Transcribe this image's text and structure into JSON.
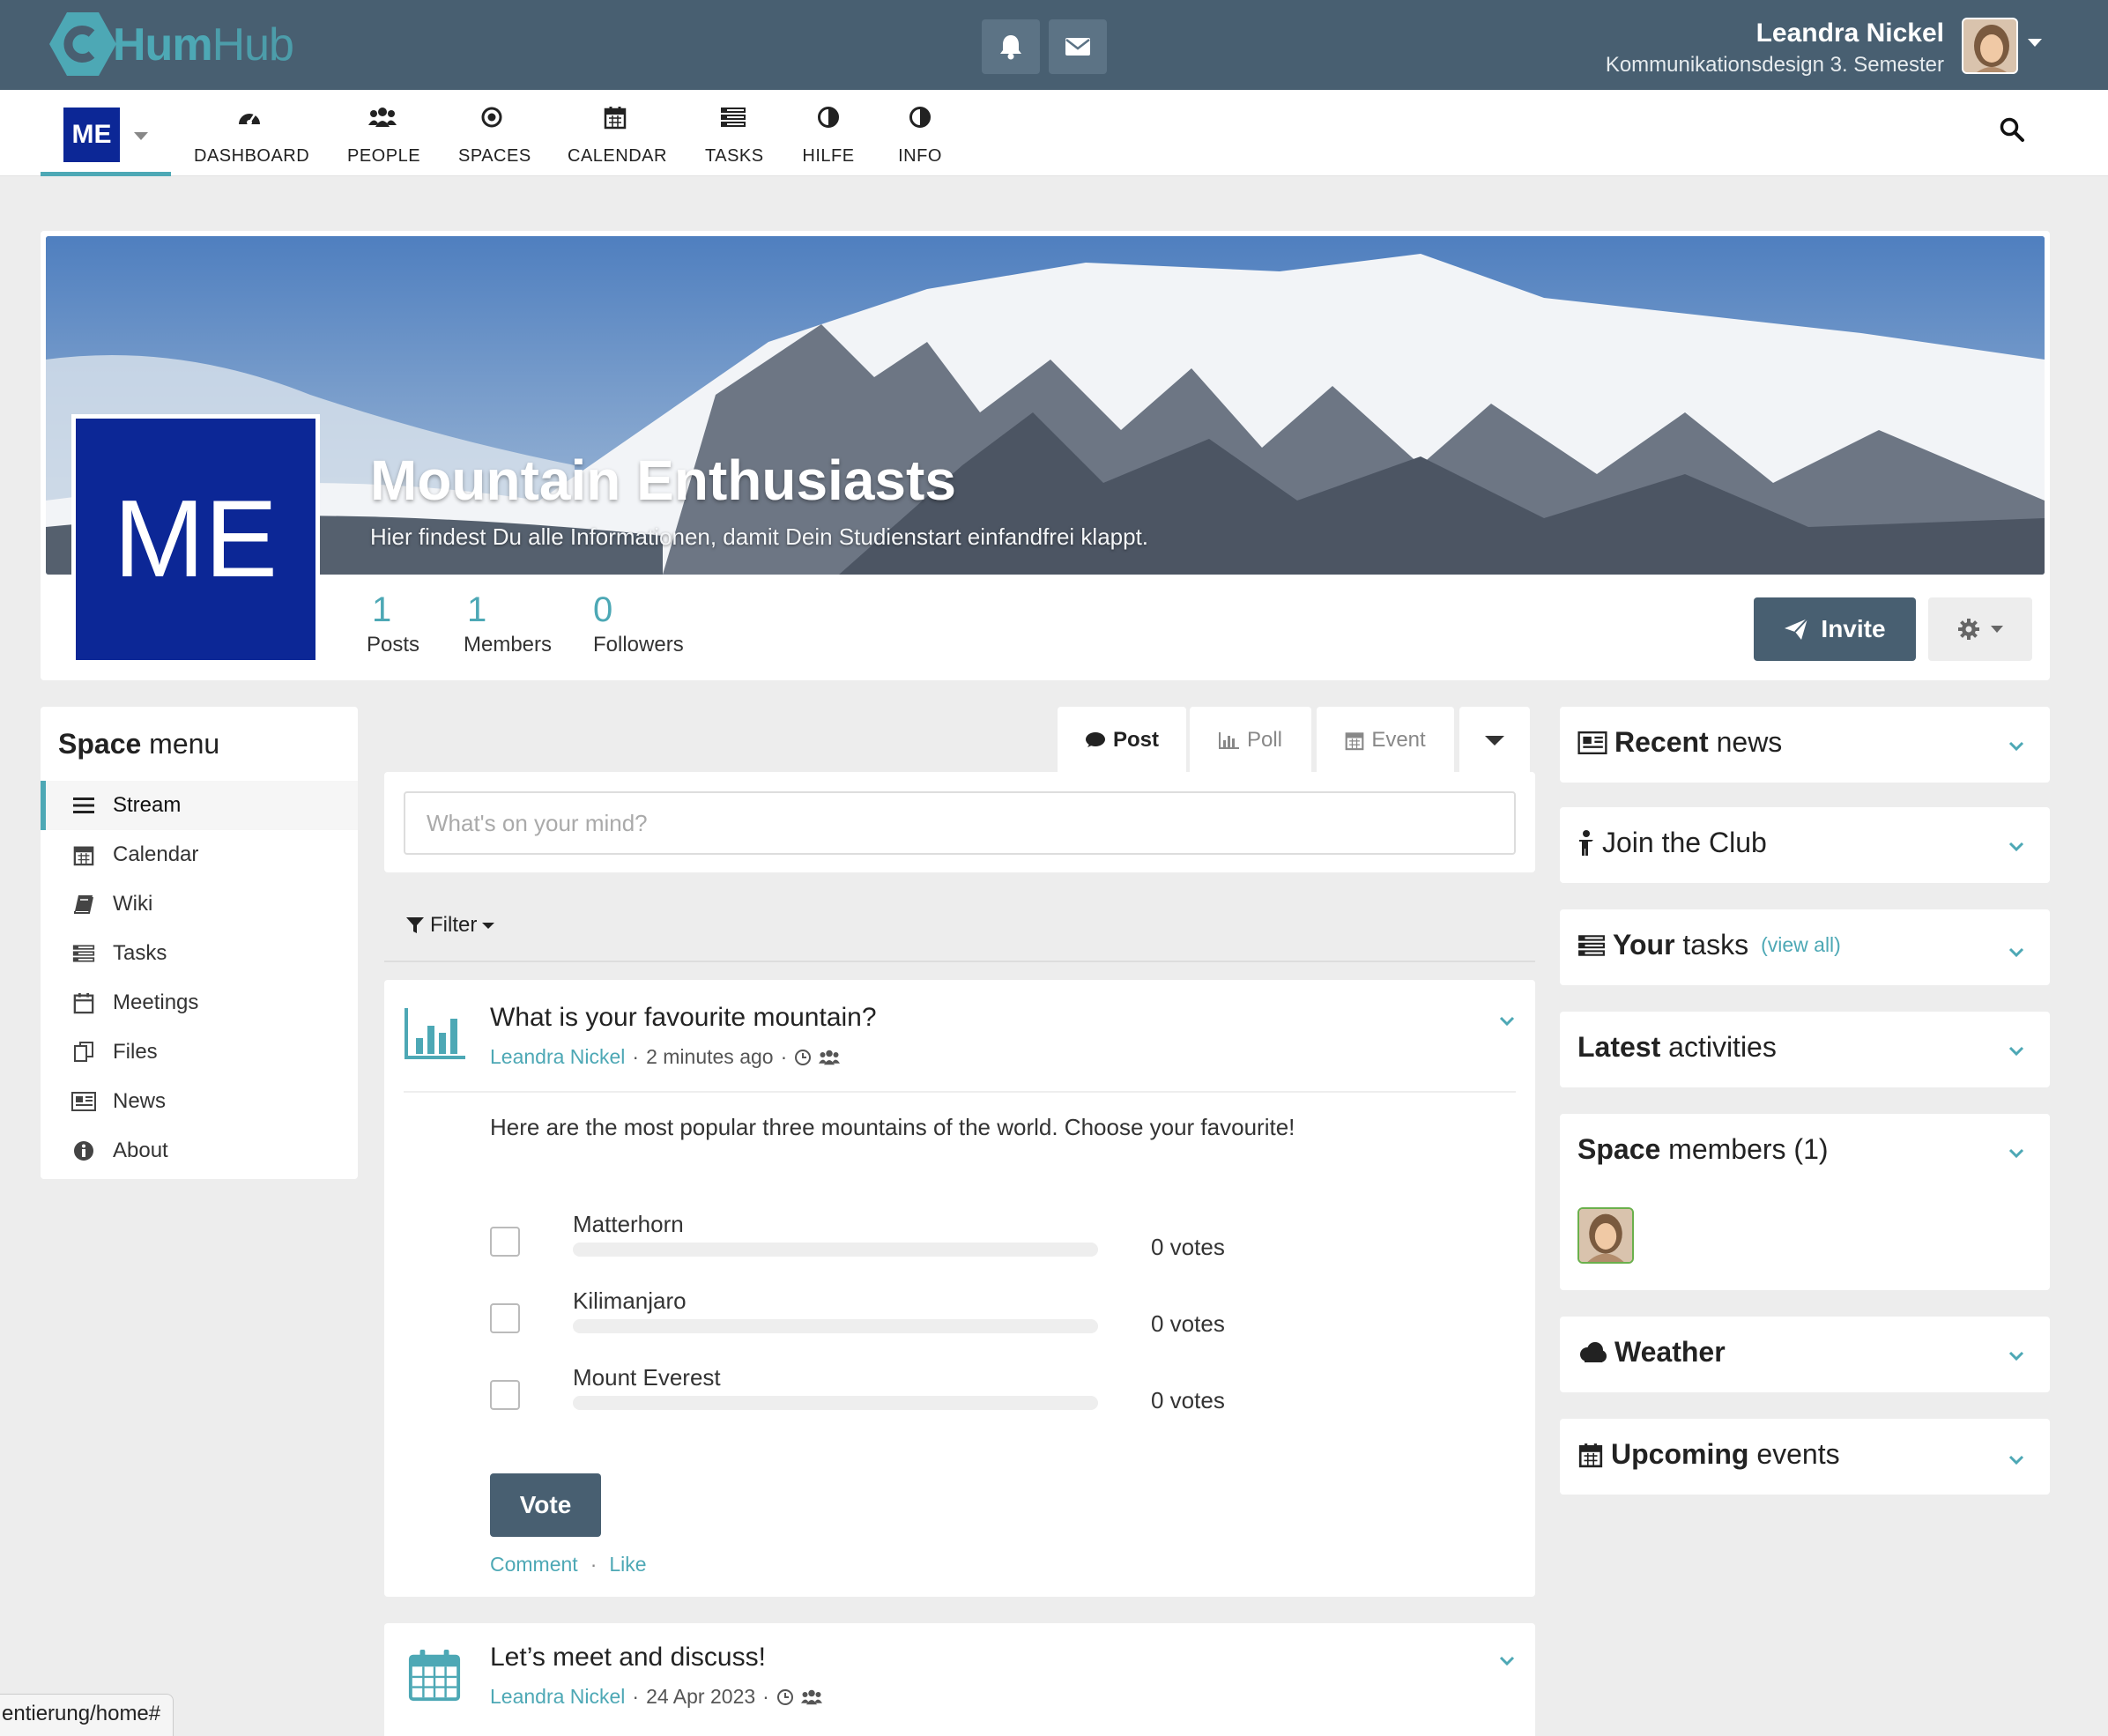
{
  "app": {
    "brand_bold": "Hum",
    "brand_light": "Hub",
    "brand_prefix": "C"
  },
  "user": {
    "name": "Leandra Nickel",
    "role": "Kommunikationsdesign 3. Semester"
  },
  "space_chooser": {
    "initials": "ME"
  },
  "nav": [
    {
      "label": "DASHBOARD",
      "icon": "dashboard-icon"
    },
    {
      "label": "PEOPLE",
      "icon": "people-icon"
    },
    {
      "label": "SPACES",
      "icon": "spaces-icon"
    },
    {
      "label": "CALENDAR",
      "icon": "calendar-icon"
    },
    {
      "label": "TASKS",
      "icon": "tasks-icon"
    },
    {
      "label": "HILFE",
      "icon": "contrast-icon"
    },
    {
      "label": "INFO",
      "icon": "contrast-icon"
    }
  ],
  "space": {
    "initials": "ME",
    "title": "Mountain Enthusiasts",
    "description": "Hier findest Du alle Informationen, damit Dein Studienstart einfandfrei klappt.",
    "stats": [
      {
        "value": "1",
        "label": "Posts"
      },
      {
        "value": "1",
        "label": "Members"
      },
      {
        "value": "0",
        "label": "Followers"
      }
    ],
    "invite_label": "Invite"
  },
  "space_menu": {
    "title_bold": "Space",
    "title_rest": " menu",
    "items": [
      {
        "label": "Stream",
        "icon": "stream-icon",
        "active": true
      },
      {
        "label": "Calendar",
        "icon": "calendar-icon",
        "active": false
      },
      {
        "label": "Wiki",
        "icon": "book-icon",
        "active": false
      },
      {
        "label": "Tasks",
        "icon": "tasks-icon",
        "active": false
      },
      {
        "label": "Meetings",
        "icon": "calendar-outline-icon",
        "active": false
      },
      {
        "label": "Files",
        "icon": "files-icon",
        "active": false
      },
      {
        "label": "News",
        "icon": "news-icon",
        "active": false
      },
      {
        "label": "About",
        "icon": "info-icon",
        "active": false
      }
    ]
  },
  "composer": {
    "tabs": [
      {
        "label": "Post",
        "icon": "comment-icon"
      },
      {
        "label": "Poll",
        "icon": "bar-chart-icon"
      },
      {
        "label": "Event",
        "icon": "calendar-icon"
      }
    ],
    "placeholder": "What's on your mind?",
    "filter_label": "Filter"
  },
  "posts": [
    {
      "title": "What is your favourite mountain?",
      "author": "Leandra Nickel",
      "time": "2 minutes ago",
      "body": "Here are the most popular three mountains of the world. Choose your favourite!",
      "options": [
        {
          "label": "Matterhorn",
          "votes": "0 votes",
          "share": 0
        },
        {
          "label": "Kilimanjaro",
          "votes": "0 votes",
          "share": 0
        },
        {
          "label": "Mount Everest",
          "votes": "0 votes",
          "share": 0
        }
      ],
      "vote_label": "Vote",
      "actions": {
        "comment": "Comment",
        "like": "Like"
      }
    },
    {
      "title": "Let’s meet and discuss!",
      "author": "Leandra Nickel",
      "time": "24 Apr 2023"
    }
  ],
  "widgets": [
    {
      "bold": "",
      "icon": "newspaper-icon",
      "bold2": "Recent",
      "rest": " news"
    },
    {
      "icon": "person-icon",
      "bold2": "",
      "rest": "Join the Club"
    },
    {
      "icon": "tasks-icon",
      "bold2": "Your",
      "rest": " tasks",
      "link": "(view all)"
    },
    {
      "icon": "",
      "bold2": "Latest",
      "rest": " activities"
    },
    {
      "icon": "",
      "bold2": "Space",
      "rest": " members (1)"
    },
    {
      "icon": "cloud-icon",
      "bold2": "Weather",
      "rest": ""
    },
    {
      "icon": "calendar-icon",
      "bold2": "Upcoming",
      "rest": " events"
    }
  ],
  "status_url": "entierung/home#",
  "colors": {
    "topbar": "#485f71",
    "accent": "#4da8b5",
    "space_blue": "#0c2796",
    "page_bg": "#ededed"
  }
}
